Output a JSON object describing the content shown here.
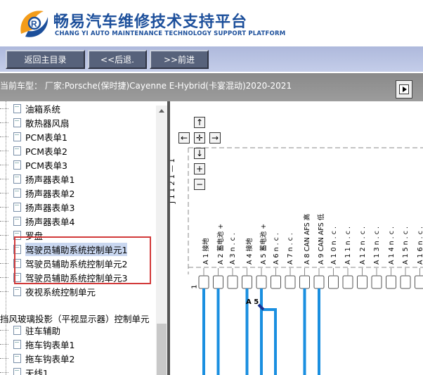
{
  "header": {
    "title": "畅易汽车维修技术支持平台",
    "subtitle": "CHANG YI AUTO MAINTENANCE TECHNOLOGY SUPPORT PLATFORM",
    "brand_color": "#1c4f9b",
    "accent_color": "#f39c1a"
  },
  "toolbar": {
    "home_label": "返回主目录",
    "back_label": "<<后退.",
    "forward_label": ">>前进"
  },
  "vehicle": {
    "text": "当前车型： 厂家:Porsche(保时捷)Cayenne E-Hybrid(卡宴混动)2020-2021"
  },
  "tree": {
    "items": [
      {
        "label": "油箱系统"
      },
      {
        "label": "散热器风扇"
      },
      {
        "label": "PCM表单1"
      },
      {
        "label": "PCM表单2"
      },
      {
        "label": "PCM表单3"
      },
      {
        "label": "扬声器表单1"
      },
      {
        "label": "扬声器表单2"
      },
      {
        "label": "扬声器表单3"
      },
      {
        "label": "扬声器表单4"
      },
      {
        "label": "罗盘"
      },
      {
        "label": "驾驶员辅助系统控制单元1"
      },
      {
        "label": "驾驶员辅助系统控制单元2"
      },
      {
        "label": "驾驶员辅助系统控制单元3"
      },
      {
        "label": ""
      },
      {
        "label": "夜视系统控制单元"
      },
      {
        "label": "挡风玻璃投影（平视显示器）控制单元"
      },
      {
        "label": "驻车辅助"
      },
      {
        "label": "拖车钩表单1"
      },
      {
        "label": "拖车钩表单2"
      },
      {
        "label": "天线1"
      }
    ]
  },
  "diagram": {
    "nav": {
      "up": "↑",
      "left": "←",
      "center": "✛",
      "right": "→",
      "down": "↓",
      "zoom_in": "+",
      "zoom_out": "−"
    },
    "connector_label": "J 1 1 2 1 — 1",
    "pins": [
      {
        "pin": "A 1",
        "func": "接地"
      },
      {
        "pin": "A 2",
        "func": "蓄电池 +"
      },
      {
        "pin": "A 3",
        "func": "n . c ."
      },
      {
        "pin": "A 4",
        "func": "接地"
      },
      {
        "pin": "A 5",
        "func": "蓄电池 +"
      },
      {
        "pin": "A 6",
        "func": "n . c ."
      },
      {
        "pin": "A 7",
        "func": "n . c ."
      },
      {
        "pin": "A 8",
        "func": "CAN AFS 高"
      },
      {
        "pin": "A 9",
        "func": "CAN AFS 低"
      },
      {
        "pin": "A 1 0",
        "func": "n . c ."
      },
      {
        "pin": "A 1 1",
        "func": "n . c ."
      },
      {
        "pin": "A 1 2",
        "func": "n . c ."
      },
      {
        "pin": "A 1 3",
        "func": "n . c ."
      },
      {
        "pin": "A 1 4",
        "func": "n . c ."
      },
      {
        "pin": "A 1 5",
        "func": "n . c ."
      },
      {
        "pin": "A 1 6",
        "func": "n . c ."
      }
    ],
    "row_marker": "1",
    "wire_label": "A 5",
    "wire_color": "#1a8fe0"
  }
}
